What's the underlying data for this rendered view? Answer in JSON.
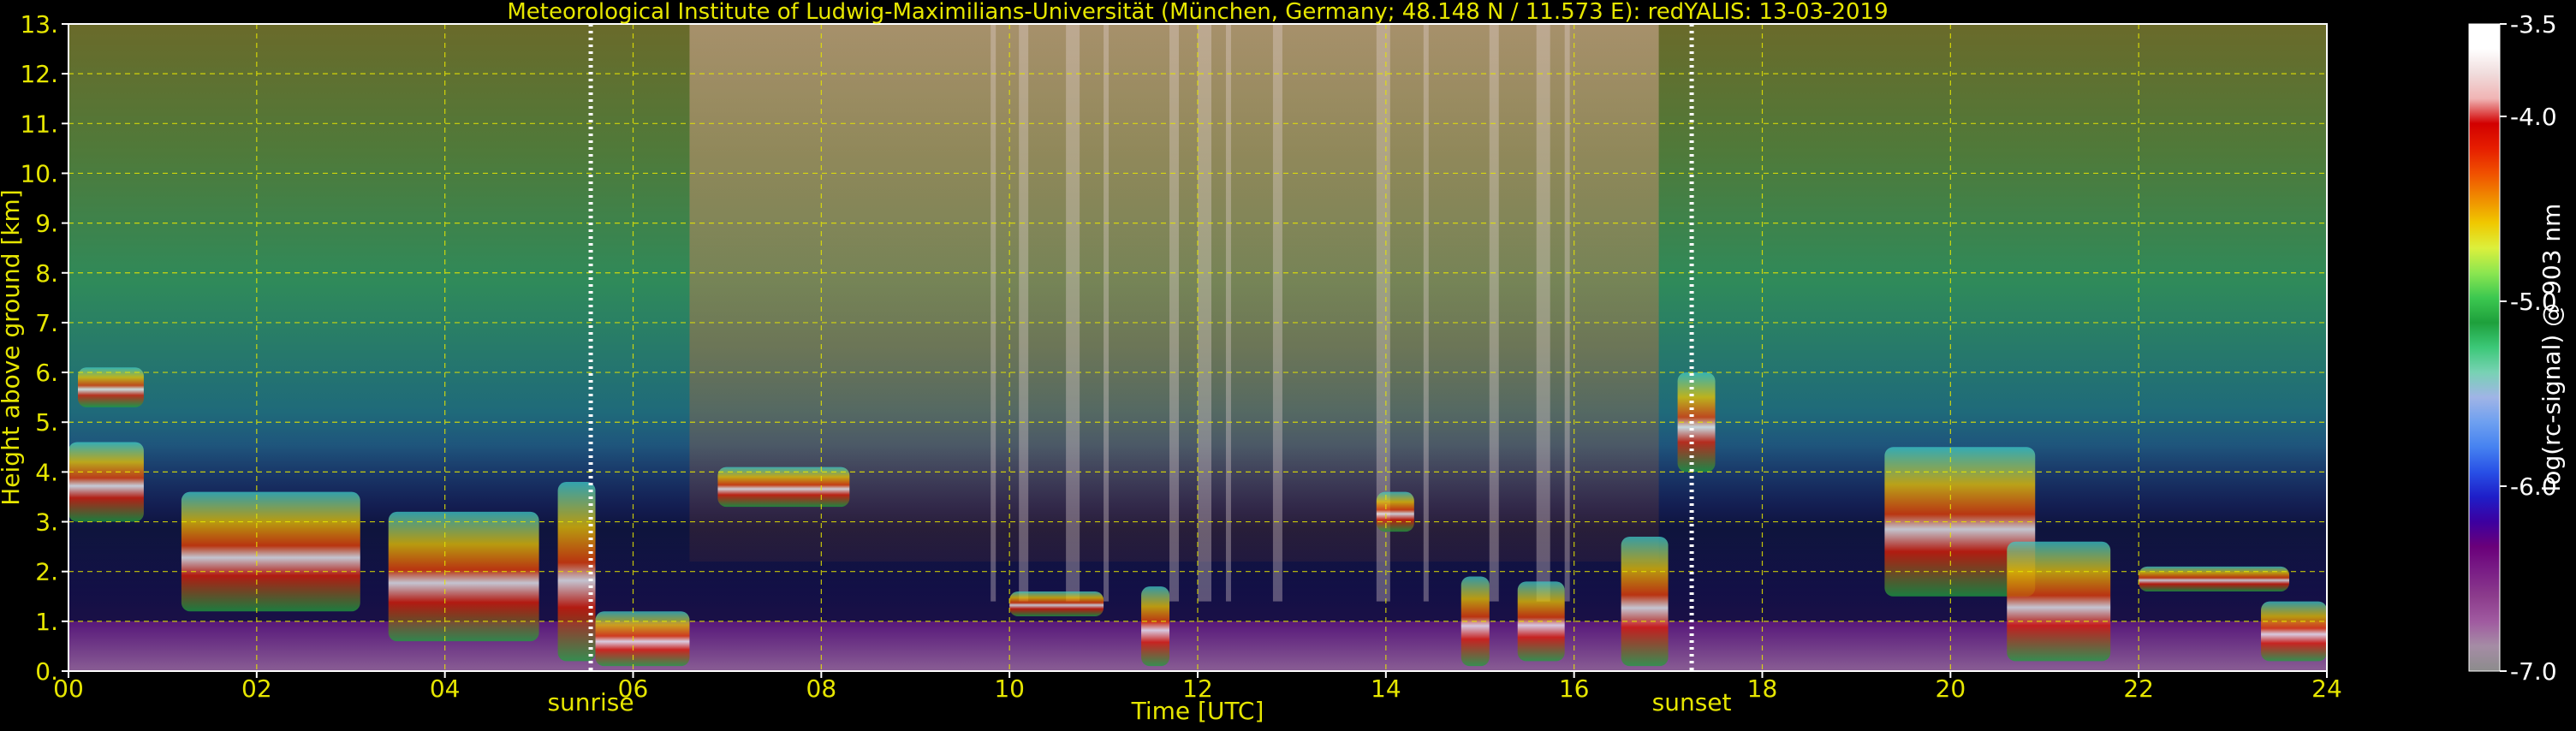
{
  "chart_data": {
    "type": "heatmap",
    "title": "Meteorological Institute of Ludwig-Maximilians-Universität (München, Germany; 48.148 N / 11.573 E):    redYALIS: 13-03-2019",
    "xlabel": "Time [UTC]",
    "ylabel": "Height above ground [km]",
    "xlim": [
      0,
      24
    ],
    "ylim": [
      0,
      13
    ],
    "x_ticks": [
      0,
      2,
      4,
      6,
      8,
      10,
      12,
      14,
      16,
      18,
      20,
      22,
      24
    ],
    "x_tick_labels": [
      "00",
      "02",
      "04",
      "06",
      "08",
      "10",
      "12",
      "14",
      "16",
      "18",
      "20",
      "22",
      "24"
    ],
    "y_ticks": [
      0,
      1,
      2,
      3,
      4,
      5,
      6,
      7,
      8,
      9,
      10,
      11,
      12,
      13
    ],
    "y_tick_labels": [
      "0.",
      "1.",
      "2.",
      "3.",
      "4.",
      "5.",
      "6.",
      "7.",
      "8.",
      "9.",
      "10.",
      "11.",
      "12.",
      "13."
    ],
    "grid": true,
    "colorbar": {
      "label": "log(rc-signal) @ 903 nm",
      "range": [
        -7.0,
        -3.5
      ],
      "ticks": [
        -7.0,
        -6.0,
        -5.0,
        -4.0,
        -3.5
      ],
      "tick_labels": [
        "-7.0",
        "-6.0",
        "-5.0",
        "-4.0",
        "-3.5"
      ],
      "colors": [
        "#8c8c8c",
        "#a58ca5",
        "#a05aa0",
        "#8c3c8c",
        "#7a1e86",
        "#6a007a",
        "#3c00a0",
        "#1e1ec8",
        "#2850e6",
        "#4682f0",
        "#6ea0f0",
        "#a0b4e6",
        "#78d2b4",
        "#3cc878",
        "#1ea03c",
        "#3cc850",
        "#8ce650",
        "#dcf03c",
        "#f0c800",
        "#f08c00",
        "#f05000",
        "#e61e00",
        "#d20000",
        "#f0b4b4",
        "#f0dcdc",
        "#ffffff",
        "#ffffff"
      ]
    },
    "annotations": [
      {
        "text": "sunrise",
        "x": 5.55
      },
      {
        "text": "sunset",
        "x": 17.25
      }
    ]
  }
}
